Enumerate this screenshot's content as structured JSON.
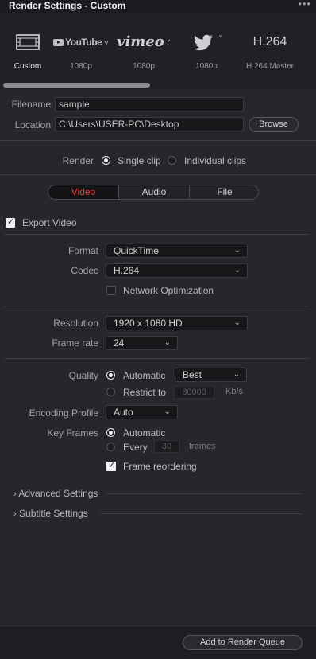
{
  "window": {
    "title": "Render Settings - Custom",
    "menu_glyph": "•••"
  },
  "presets": [
    {
      "name": "Custom",
      "icon": "film-strip-icon"
    },
    {
      "name": "1080p",
      "logo": "YouTube",
      "icon": "youtube-icon"
    },
    {
      "name": "1080p",
      "logo": "vimeo",
      "icon": "vimeo-icon"
    },
    {
      "name": "1080p",
      "logo": "",
      "icon": "twitter-bird-icon"
    },
    {
      "name": "H.264 Master",
      "logo": "H.264",
      "icon": "h264-icon"
    }
  ],
  "file": {
    "filename_label": "Filename",
    "filename_value": "sample",
    "location_label": "Location",
    "location_value": "C:\\Users\\USER-PC\\Desktop",
    "browse_label": "Browse"
  },
  "render": {
    "label": "Render",
    "single_clip": "Single clip",
    "individual_clips": "Individual clips",
    "selected": "single"
  },
  "tabs": [
    "Video",
    "Audio",
    "File"
  ],
  "video": {
    "export_video_label": "Export Video",
    "export_video_checked": true,
    "format_label": "Format",
    "format_value": "QuickTime",
    "codec_label": "Codec",
    "codec_value": "H.264",
    "network_opt_label": "Network Optimization",
    "resolution_label": "Resolution",
    "resolution_value": "1920 x 1080 HD",
    "framerate_label": "Frame rate",
    "framerate_value": "24",
    "quality_label": "Quality",
    "quality_auto": "Automatic",
    "quality_auto_value": "Best",
    "quality_restrict": "Restrict to",
    "quality_restrict_value": "80000",
    "quality_restrict_unit": "Kb/s",
    "encoding_label": "Encoding Profile",
    "encoding_value": "Auto",
    "keyframes_label": "Key Frames",
    "keyframes_auto": "Automatic",
    "keyframes_every": "Every",
    "keyframes_every_value": "30",
    "keyframes_unit": "frames",
    "frame_reordering_label": "Frame reordering"
  },
  "sections": {
    "advanced": "Advanced Settings",
    "subtitle": "Subtitle Settings"
  },
  "footer": {
    "add_queue": "Add to Render Queue"
  },
  "colors": {
    "accent": "#e33b3b",
    "panel": "#26262b"
  }
}
